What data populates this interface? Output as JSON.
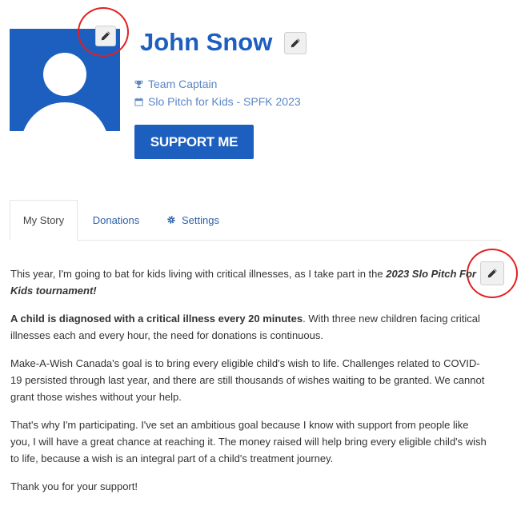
{
  "profile": {
    "name": "John Snow",
    "role": "Team Captain",
    "event": "Slo Pitch for Kids - SPFK 2023",
    "support_label": "SUPPORT ME"
  },
  "tabs": [
    {
      "label": "My Story",
      "active": true
    },
    {
      "label": "Donations",
      "active": false
    },
    {
      "label": "Settings",
      "active": false,
      "icon": "gear-icon"
    }
  ],
  "story": {
    "p1_text": "This year, I'm going to bat for kids living with critical illnesses, as I take part in the ",
    "p1_emphasis": "2023 Slo Pitch For Kids tournament!",
    "p2_bold": "A child is diagnosed with a critical illness every 20 minutes",
    "p2_text": ". With three new children facing critical illnesses each and every hour, the need for donations is continuous.",
    "p3": "Make-A-Wish Canada's goal is to bring every eligible child's wish to life. Challenges related to COVID-19 persisted through last year, and there are still thousands of wishes waiting to be granted. We cannot grant those wishes without your help.",
    "p4": "That's why I'm participating. I've set an ambitious goal because I know with support from people like you, I will have a great chance at reaching it. The money raised will help bring every eligible child's wish to life, because a wish is an integral part of a child's treatment journey.",
    "p5": "Thank you for your support!"
  },
  "icons": {
    "avatar": "default-user-avatar",
    "edit": "pencil-icon",
    "role": "trophy-icon",
    "event": "calendar-icon"
  },
  "colors": {
    "brand_blue": "#1d5fbf",
    "meta_blue": "#5b86c7",
    "annotation_red": "#e02020"
  }
}
